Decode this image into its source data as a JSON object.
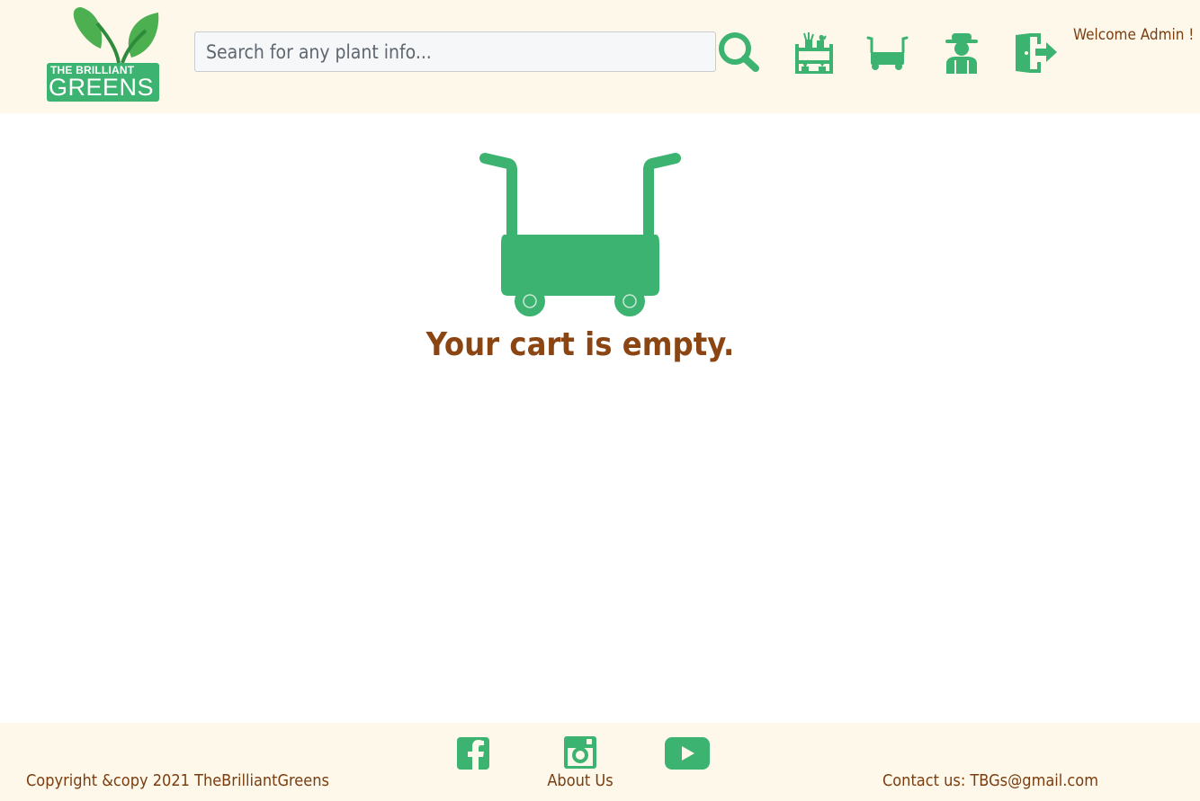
{
  "brand": {
    "logo_line1": "THE BRILLIANT",
    "logo_line2": "GREENS",
    "color": "#3cb371"
  },
  "header": {
    "search_placeholder": "Search for any plant info...",
    "welcome_text": "Welcome Admin !",
    "icons": [
      "search-icon",
      "plant-shelf-icon",
      "cart-icon",
      "gardener-profile-icon",
      "logout-door-icon"
    ]
  },
  "main": {
    "empty_message": "Your cart is empty."
  },
  "footer": {
    "copyright": "Copyright &copy 2021 TheBrilliantGreens",
    "about_label": "About Us",
    "contact": "Contact us: TBGs@gmail.com",
    "social_icons": [
      "facebook-icon",
      "instagram-icon",
      "youtube-icon"
    ]
  },
  "colors": {
    "accent_green": "#3cb371",
    "text_brown": "#8b4513",
    "header_bg": "#fdf8ea"
  }
}
